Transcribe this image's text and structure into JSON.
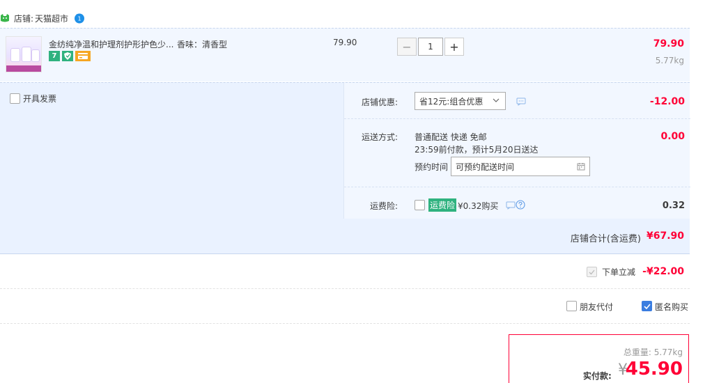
{
  "shop": {
    "label": "店铺:",
    "name": "天猫超市",
    "ww_count": "1"
  },
  "item": {
    "title": "金纺纯净温和护理剂护形护色少...",
    "spec": "香味：清香型",
    "unit_price": "79.90",
    "quantity": "1",
    "total": "79.90",
    "weight": "5.77kg",
    "badge_seven": "7"
  },
  "invoice": {
    "label": "开具发票"
  },
  "services": {
    "discount_label": "店铺优惠:",
    "discount_select": "省12元:组合优惠",
    "discount_amount": "-12.00",
    "shipping_label": "运送方式:",
    "shipping_line1": "普通配送 快递 免邮",
    "shipping_line2": "23:59前付款，预计5月20日送达",
    "schedule_label": "预约时间",
    "schedule_placeholder": "可预约配送时间",
    "shipping_amount": "0.00",
    "insurance_label": "运费险:",
    "insurance_tag": "运费险",
    "insurance_price": "¥0.32购买",
    "insurance_amount": "0.32"
  },
  "shop_total": {
    "label": "店铺合计(含运费)",
    "value": "¥67.90"
  },
  "order_discount": {
    "label": "下单立减",
    "value": "-¥22.00"
  },
  "options": {
    "friend_pay": "朋友代付",
    "anonymous": "匿名购买"
  },
  "payment": {
    "weight_label": "总重量: 5.77kg",
    "pay_label": "实付款:",
    "yen": "¥",
    "value": "45.90"
  },
  "colors": {
    "price_red": "#ff0036",
    "panel_blue": "#eaf2ff",
    "tag_green": "#2fb27f",
    "check_blue": "#3a7de0"
  }
}
